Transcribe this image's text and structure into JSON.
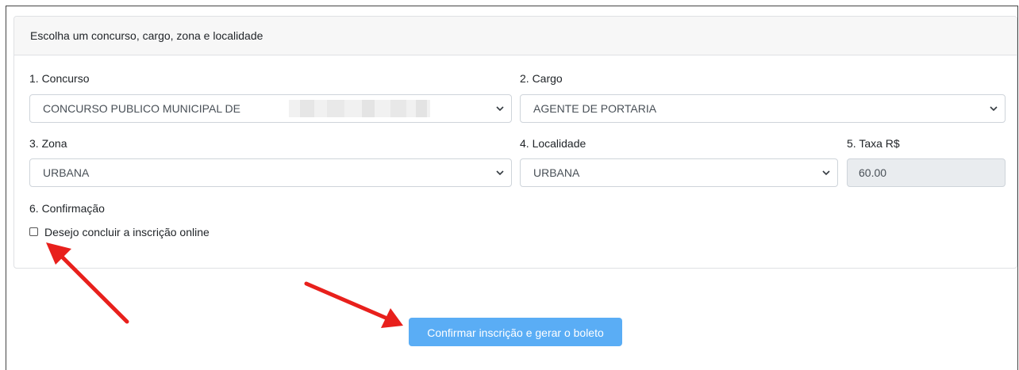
{
  "card": {
    "header": "Escolha um concurso, cargo, zona e localidade"
  },
  "fields": {
    "concurso": {
      "label": "1. Concurso",
      "value": "CONCURSO PUBLICO MUNICIPAL DE"
    },
    "cargo": {
      "label": "2. Cargo",
      "value": "AGENTE DE PORTARIA"
    },
    "zona": {
      "label": "3. Zona",
      "value": "URBANA"
    },
    "localidade": {
      "label": "4. Localidade",
      "value": "URBANA"
    },
    "taxa": {
      "label": "5. Taxa R$",
      "value": "60.00"
    }
  },
  "confirmation": {
    "label": "6. Confirmação",
    "checkbox_label": "Desejo concluir a inscrição online",
    "checked": false
  },
  "submit": {
    "label": "Confirmar inscrição e gerar o boleto"
  },
  "colors": {
    "button_bg": "#5aadf5",
    "annotation_arrow": "#e8201c"
  },
  "icons": {
    "select_caret": "chevron-down-icon",
    "annotation": "red-arrow-icon"
  }
}
